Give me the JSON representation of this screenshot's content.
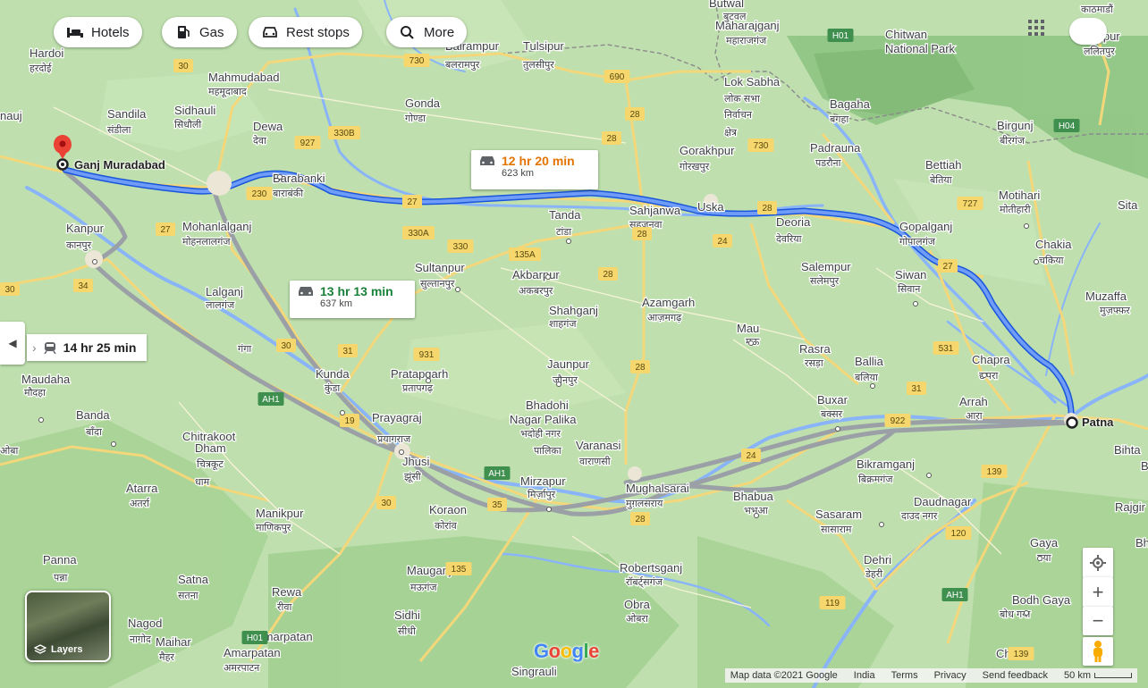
{
  "chips": [
    {
      "label": "Hotels",
      "icon": "bed-icon"
    },
    {
      "label": "Gas",
      "icon": "gas-station-icon"
    },
    {
      "label": "Rest stops",
      "icon": "car-icon"
    },
    {
      "label": "More",
      "icon": "search-icon"
    }
  ],
  "routes": {
    "selected": {
      "time": "12 hr 20 min",
      "distance": "623 km"
    },
    "alt1": {
      "time": "13 hr 13 min",
      "distance": "637 km"
    },
    "alt2": {
      "time": "14 hr 25 min"
    }
  },
  "origin": "Ganj Muradabad",
  "destination": "Patna",
  "layers_label": "Layers",
  "google_logo": [
    "G",
    "o",
    "o",
    "g",
    "l",
    "e"
  ],
  "logo_colors": [
    "#4285F4",
    "#EA4335",
    "#FBBC05",
    "#4285F4",
    "#34A853",
    "#EA4335"
  ],
  "attribution": [
    "Map data ©2021 Google",
    "India",
    "Terms",
    "Privacy",
    "Send feedback"
  ],
  "scale": "50 km",
  "colors": {
    "selected_route": "#4a7cf0",
    "alt_route": "#9aa0a6",
    "origin_pin": "#ea4335",
    "water": "#8ab4f8",
    "highway": "#f7e07a",
    "land": "#b9dba8"
  },
  "places": [
    {
      "n": "Hardoi"
    },
    {
      "n": "हरदोई"
    },
    {
      "n": "Sandila"
    },
    {
      "n": "संडीला"
    },
    {
      "n": "Sidhauli"
    },
    {
      "n": "सिधौली"
    },
    {
      "n": "Mahmudabad"
    },
    {
      "n": "महमूदाबाद"
    },
    {
      "n": "Dewa"
    },
    {
      "n": "देवा"
    },
    {
      "n": "Barabanki"
    },
    {
      "n": "बाराबंकी"
    },
    {
      "n": "Kanpur"
    },
    {
      "n": "कानपुर"
    },
    {
      "n": "Mohanlalganj"
    },
    {
      "n": "मोहनलालगंज"
    },
    {
      "n": "Gonda"
    },
    {
      "n": "गोण्डा"
    },
    {
      "n": "Balrampur"
    },
    {
      "n": "बलरामपुर"
    },
    {
      "n": "Tulsipur"
    },
    {
      "n": "तुलसीपुर"
    },
    {
      "n": "Gorakhpur"
    },
    {
      "n": "गोरखपुर"
    },
    {
      "n": "Sahjanwa"
    },
    {
      "n": "सहजनवा"
    },
    {
      "n": "Deoria"
    },
    {
      "n": "देवरिया"
    },
    {
      "n": "Gopalganj"
    },
    {
      "n": "गोपालगंज"
    },
    {
      "n": "Siwan"
    },
    {
      "n": "सिवान"
    },
    {
      "n": "Tanda"
    },
    {
      "n": "टांडा"
    },
    {
      "n": "Akbarpur"
    },
    {
      "n": "अकबरपुर"
    },
    {
      "n": "Sultanpur"
    },
    {
      "n": "सुल्तानपुर"
    },
    {
      "n": "Azamgarh"
    },
    {
      "n": "आज़मगढ़"
    },
    {
      "n": "Shahganj"
    },
    {
      "n": "शाहगंज"
    },
    {
      "n": "Mau"
    },
    {
      "n": "मऊ"
    },
    {
      "n": "Ballia"
    },
    {
      "n": "बलिया"
    },
    {
      "n": "Chapra"
    },
    {
      "n": "छपरा"
    },
    {
      "n": "Jaunpur"
    },
    {
      "n": "जौनपुर"
    },
    {
      "n": "Bhadohi"
    },
    {
      "n": "Nagar Palika"
    },
    {
      "n": "भदोही नगर"
    },
    {
      "n": "पालिका"
    },
    {
      "n": "Varanasi"
    },
    {
      "n": "वाराणसी"
    },
    {
      "n": "Mirzapur"
    },
    {
      "n": "मिर्ज़ापुर"
    },
    {
      "n": "Mughalsarai"
    },
    {
      "n": "मुग़लसराय"
    },
    {
      "n": "Bhabua"
    },
    {
      "n": "भभुआ"
    },
    {
      "n": "Buxar"
    },
    {
      "n": "बक्सर"
    },
    {
      "n": "Arrah"
    },
    {
      "n": "आरा"
    },
    {
      "n": "Bikramganj"
    },
    {
      "n": "बिक्रमगंज"
    },
    {
      "n": "Daudnagar"
    },
    {
      "n": "दाउद नगर"
    },
    {
      "n": "Sasaram"
    },
    {
      "n": "सासाराम"
    },
    {
      "n": "Prayagraj"
    },
    {
      "n": "प्रयागराज"
    },
    {
      "n": "Jhusi"
    },
    {
      "n": "झूंसी"
    },
    {
      "n": "Kunda"
    },
    {
      "n": "कुंडा"
    },
    {
      "n": "Pratapgarh"
    },
    {
      "n": "प्रतापगढ़"
    },
    {
      "n": "Lalganj"
    },
    {
      "n": "लालगंज"
    },
    {
      "n": "Maudaha"
    },
    {
      "n": "मौदहा"
    },
    {
      "n": "Banda"
    },
    {
      "n": "बाँदा"
    },
    {
      "n": "Chitrakoot"
    },
    {
      "n": "Dham"
    },
    {
      "n": "चित्रकूट"
    },
    {
      "n": "धाम"
    },
    {
      "n": "Atarra"
    },
    {
      "n": "अतर्रा"
    },
    {
      "n": "Manikpur"
    },
    {
      "n": "माणिकपुर"
    },
    {
      "n": "Koraon"
    },
    {
      "n": "कोरांव"
    },
    {
      "n": "Mauganj"
    },
    {
      "n": "मऊगंज"
    },
    {
      "n": "Rewa"
    },
    {
      "n": "रीवा"
    },
    {
      "n": "Satna"
    },
    {
      "n": "सतना"
    },
    {
      "n": "Panna"
    },
    {
      "n": "पन्ना"
    },
    {
      "n": "Nagod"
    },
    {
      "n": "नागोद"
    },
    {
      "n": "Maihar"
    },
    {
      "n": "मैहर"
    },
    {
      "n": "Amarpatan"
    },
    {
      "n": "अमरपाटन"
    },
    {
      "n": "Sidhi"
    },
    {
      "n": "सीधी"
    },
    {
      "n": "Robertsganj"
    },
    {
      "n": "रॉबर्ट्सगंज"
    },
    {
      "n": "Obra"
    },
    {
      "n": "ओबरा"
    },
    {
      "n": "Dehri"
    },
    {
      "n": "डेहरी"
    },
    {
      "n": "Gaya"
    },
    {
      "n": "गया"
    },
    {
      "n": "Bodh Gaya"
    },
    {
      "n": "बोध गया"
    },
    {
      "n": "Chatra"
    },
    {
      "n": "Singrauli"
    },
    {
      "n": "Bagaha"
    },
    {
      "n": "बगहा"
    },
    {
      "n": "Maharajganj"
    },
    {
      "n": "महाराजगंज"
    },
    {
      "n": "Padrauna"
    },
    {
      "n": "पडरौना"
    },
    {
      "n": "Bettiah"
    },
    {
      "n": "बेतिया"
    },
    {
      "n": "Motihari"
    },
    {
      "n": "मोतीहारी"
    },
    {
      "n": "Birgunj"
    },
    {
      "n": "बीरगंज"
    },
    {
      "n": "Chitwan"
    },
    {
      "n": "National Park"
    },
    {
      "n": "Muzaffa"
    },
    {
      "n": "मुज़फ्फर"
    },
    {
      "n": "Chakia"
    },
    {
      "n": "चकिया"
    },
    {
      "n": "Salempur"
    },
    {
      "n": "सलेमपुर"
    },
    {
      "n": "Rasra"
    },
    {
      "n": "रसड़ा"
    },
    {
      "n": "Bihta"
    },
    {
      "n": "Rajgir"
    },
    {
      "n": "Bhagwan"
    },
    {
      "n": "Lalitpur"
    },
    {
      "n": "ललितपुर"
    },
    {
      "n": "काठमाडौं"
    },
    {
      "n": "Butwal"
    },
    {
      "n": "बुटवल"
    },
    {
      "n": "Uska"
    },
    {
      "n": "Lok Sabha"
    },
    {
      "n": "लोक सभा"
    },
    {
      "n": "निर्वाचन"
    },
    {
      "n": "क्षेत्र"
    },
    {
      "n": "गंगा"
    },
    {
      "n": "Sita"
    },
    {
      "n": "Bha"
    },
    {
      "n": "nauj"
    },
    {
      "n": "ओबा"
    },
    {
      "n": "शाहगंज"
    },
    {
      "n": "Amarpatan"
    }
  ],
  "road_shields": [
    "30",
    "730",
    "690",
    "28",
    "927",
    "330B",
    "730",
    "28",
    "230",
    "27",
    "28",
    "27",
    "28",
    "24",
    "330A",
    "330",
    "135A",
    "28",
    "727",
    "531",
    "28",
    "31",
    "30",
    "931",
    "19",
    "28",
    "31",
    "922",
    "AH1",
    "AH1",
    "24",
    "139",
    "35",
    "30",
    "135",
    "120",
    "119",
    "139",
    "AH1",
    "34",
    "27",
    "30",
    "H01",
    "H01",
    "H04"
  ]
}
